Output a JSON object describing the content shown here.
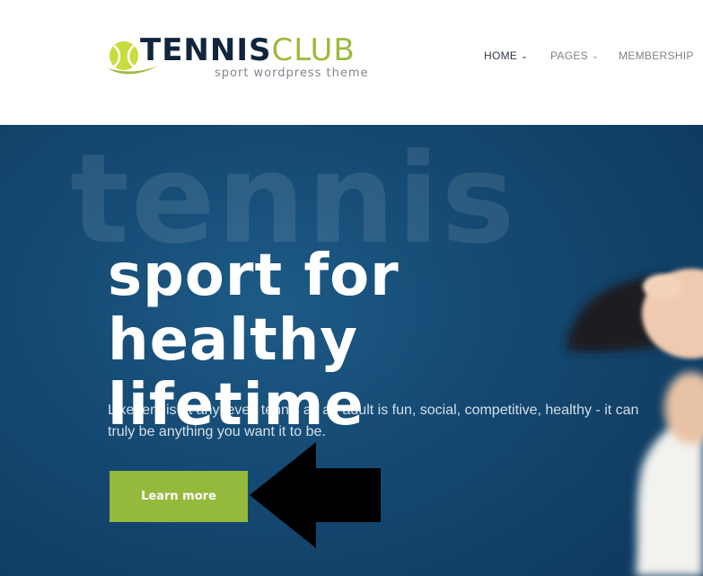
{
  "brand": {
    "name_bold": "TENNIS",
    "name_light": "CLUB",
    "tagline": "sport wordpress theme",
    "colors": {
      "navy": "#11263c",
      "green": "#9dbb3c",
      "ball": "#c9dc3c"
    }
  },
  "nav": {
    "items": [
      {
        "label": "HOME",
        "has_dropdown": true,
        "active": true
      },
      {
        "label": "PAGES",
        "has_dropdown": true,
        "active": false
      },
      {
        "label": "MEMBERSHIP",
        "has_dropdown": false,
        "active": false
      }
    ],
    "chevron_icon": "chevron-down-icon",
    "colors": {
      "active": "#2f3a45",
      "inactive": "#7d848b"
    }
  },
  "hero": {
    "watermark": "tennis",
    "title_lines": [
      "sport for",
      "healthy",
      "lifetime"
    ],
    "description": "Like tennis at any level, tennis as an adult is fun, social, competitive, healthy - it can truly be anything you want it to be.",
    "cta_label": "Learn more",
    "colors": {
      "background": "#154a74",
      "button": "#94b93b",
      "text": "#ffffff"
    }
  },
  "annotation": {
    "icon": "arrow-left-icon",
    "color": "#000000"
  }
}
